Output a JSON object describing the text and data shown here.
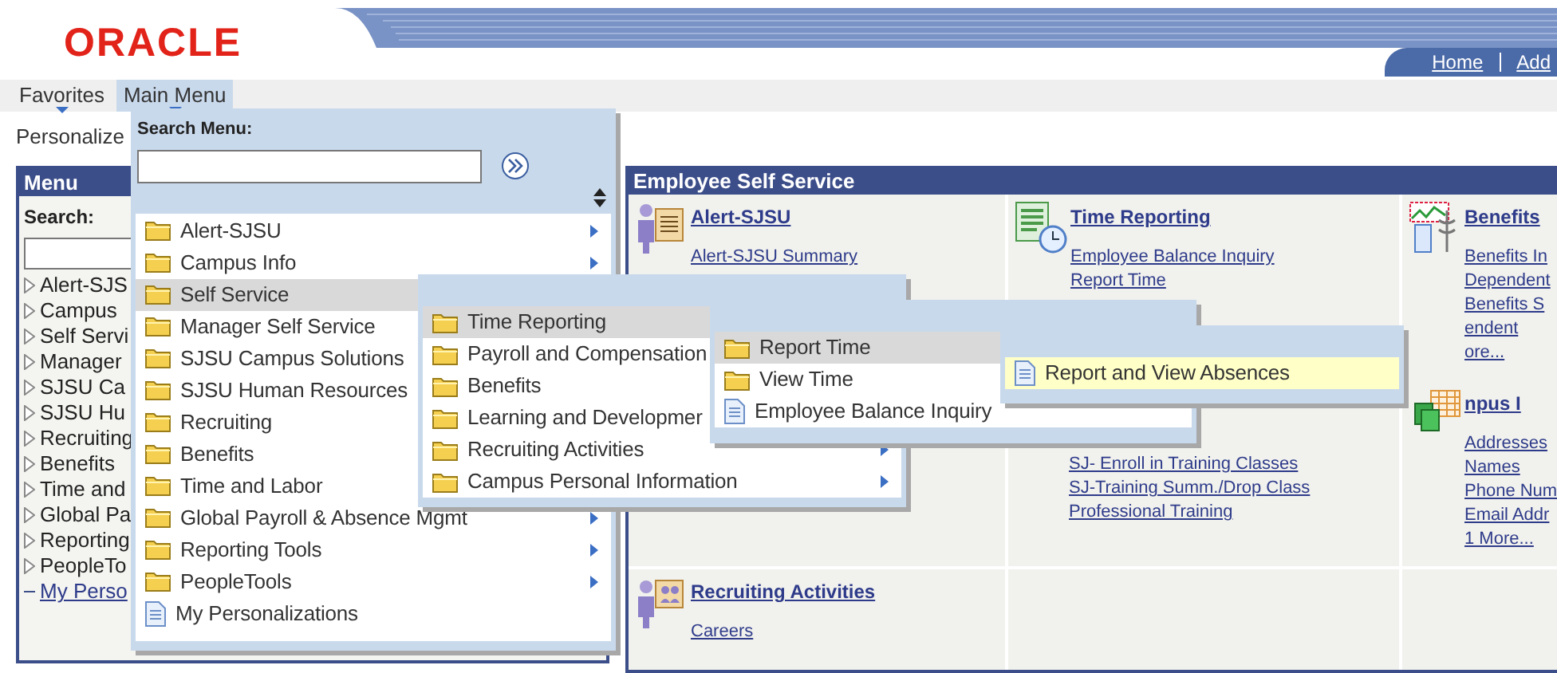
{
  "header": {
    "logo": "ORACLE",
    "links": [
      {
        "label": "Home"
      },
      {
        "label": "Add"
      }
    ]
  },
  "nav": [
    {
      "label": "Favorites",
      "selected": false
    },
    {
      "label": "Main Menu",
      "selected": true
    }
  ],
  "personalize": "Personalize",
  "sidebar": {
    "title": "Menu",
    "search_label": "Search:",
    "items": [
      {
        "label": "Alert-SJS",
        "kind": "folder"
      },
      {
        "label": "Campus",
        "kind": "folder"
      },
      {
        "label": "Self Servi",
        "kind": "folder"
      },
      {
        "label": "Manager",
        "kind": "folder"
      },
      {
        "label": "SJSU Ca",
        "kind": "folder"
      },
      {
        "label": "SJSU Hu",
        "kind": "folder"
      },
      {
        "label": "Recruiting",
        "kind": "folder"
      },
      {
        "label": "Benefits",
        "kind": "folder"
      },
      {
        "label": "Time and",
        "kind": "folder"
      },
      {
        "label": "Global Pa",
        "kind": "folder"
      },
      {
        "label": "Reporting",
        "kind": "folder"
      },
      {
        "label": "PeopleTo",
        "kind": "folder"
      },
      {
        "label": "My Perso",
        "kind": "link"
      }
    ]
  },
  "portal": {
    "title": "Employee Self Service",
    "rows": [
      {
        "cells": [
          {
            "sections": [
              {
                "title": "Alert-SJSU",
                "kind": "alert",
                "links": [
                  "Alert-SJSU Summary"
                ]
              }
            ]
          },
          {
            "sections": [
              {
                "title": "Time Reporting",
                "kind": "timesheet",
                "links": [
                  "Employee Balance Inquiry",
                  "Report Time"
                ]
              },
              {
                "kind": "plain",
                "links": [
                  "SJ- Enroll in Training Classes",
                  "SJ-Training Summ./Drop Class",
                  "Professional Training"
                ]
              }
            ]
          },
          {
            "sections": [
              {
                "title": "Benefits",
                "kind": "benefits",
                "links": [
                  "Benefits In",
                  "Dependent",
                  "Benefits S",
                  "endent",
                  "ore..."
                ]
              },
              {
                "title": "npus I",
                "kind": "campus",
                "links": [
                  "Addresses",
                  "Names",
                  "Phone Num",
                  "Email Addr",
                  "1 More..."
                ]
              }
            ]
          }
        ]
      },
      {
        "cells": [
          {
            "sections": [
              {
                "title": "Recruiting Activities",
                "kind": "recruiting",
                "links": [
                  "Careers"
                ]
              }
            ]
          },
          {},
          {}
        ]
      }
    ]
  },
  "main_menu": {
    "search_label": "Search Menu:",
    "items": [
      {
        "label": "Alert-SJSU",
        "kind": "folder",
        "arrow": true,
        "selected": false
      },
      {
        "label": "Campus Info",
        "kind": "folder",
        "arrow": true,
        "selected": false
      },
      {
        "label": "Self Service",
        "kind": "folder",
        "arrow": false,
        "selected": true
      },
      {
        "label": "Manager Self Service",
        "kind": "folder",
        "arrow": false,
        "selected": false
      },
      {
        "label": "SJSU Campus Solutions",
        "kind": "folder",
        "arrow": false,
        "selected": false
      },
      {
        "label": "SJSU Human Resources",
        "kind": "folder",
        "arrow": false,
        "selected": false
      },
      {
        "label": "Recruiting",
        "kind": "folder",
        "arrow": false,
        "selected": false
      },
      {
        "label": "Benefits",
        "kind": "folder",
        "arrow": false,
        "selected": false
      },
      {
        "label": "Time and Labor",
        "kind": "folder",
        "arrow": false,
        "selected": false
      },
      {
        "label": "Global Payroll & Absence Mgmt",
        "kind": "folder",
        "arrow": true,
        "selected": false
      },
      {
        "label": "Reporting Tools",
        "kind": "folder",
        "arrow": true,
        "selected": false
      },
      {
        "label": "PeopleTools",
        "kind": "folder",
        "arrow": true,
        "selected": false
      },
      {
        "label": "My Personalizations",
        "kind": "page",
        "arrow": false,
        "selected": false
      }
    ]
  },
  "submenus": [
    {
      "items": [
        {
          "label": "Time Reporting",
          "kind": "folder",
          "arrow": false,
          "selected": true
        },
        {
          "label": "Payroll and Compensation",
          "kind": "folder",
          "arrow": false,
          "selected": false
        },
        {
          "label": "Benefits",
          "kind": "folder",
          "arrow": false,
          "selected": false
        },
        {
          "label": "Learning and Developmer",
          "kind": "folder",
          "arrow": false,
          "selected": false
        },
        {
          "label": "Recruiting Activities",
          "kind": "folder",
          "arrow": true,
          "selected": false
        },
        {
          "label": "Campus Personal Information",
          "kind": "folder",
          "arrow": true,
          "selected": false
        }
      ]
    },
    {
      "items": [
        {
          "label": "Report Time",
          "kind": "folder",
          "arrow": false,
          "selected": true
        },
        {
          "label": "View Time",
          "kind": "folder",
          "arrow": false,
          "selected": false
        },
        {
          "label": "Employee Balance Inquiry",
          "kind": "page",
          "arrow": false,
          "selected": false
        }
      ]
    },
    {
      "items": [
        {
          "label": "Report and View Absences",
          "kind": "page",
          "arrow": false,
          "selected": true
        }
      ]
    }
  ]
}
